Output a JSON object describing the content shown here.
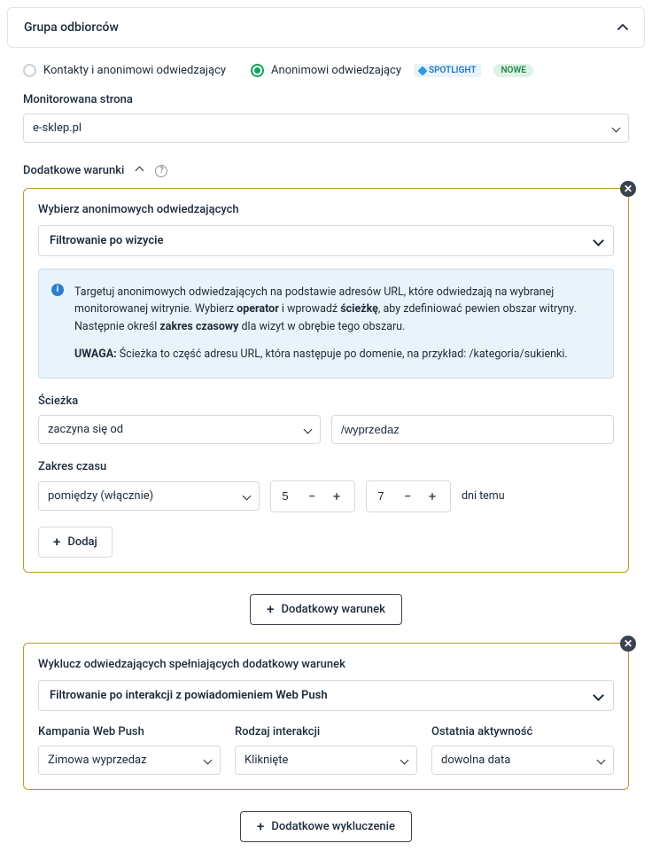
{
  "panel": {
    "title": "Grupa odbiorców"
  },
  "radios": {
    "opt1": "Kontakty i anonimowi odwiedzający",
    "opt2": "Anonimowi odwiedzający",
    "spotlight": "SPOTLIGHT",
    "new": "NOWE"
  },
  "monitored": {
    "label": "Monitorowana strona",
    "value": "e-sklep.pl"
  },
  "additional": {
    "label": "Dodatkowe warunki"
  },
  "filter1": {
    "title": "Wybierz anonimowych odwiedzających",
    "select": "Filtrowanie po wizycie",
    "info_p1_a": "Targetuj anonimowych odwiedzających na podstawie adresów URL, które odwiedzają na wybranej monitorowanej witrynie. Wybierz ",
    "info_op": "operator",
    "info_p1_b": " i wprowadź ",
    "info_path": "ścieżkę",
    "info_p1_c": ", aby zdefiniować pewien obszar witryny. Następnie określ ",
    "info_time": "zakres czasowy",
    "info_p1_d": " dla wizyt w obrębie tego obszaru.",
    "info_p2_a": "UWAGA:",
    "info_p2_b": " Ścieżka to część adresu URL, która następuje po domenie, na przykład: /kategoria/sukienki.",
    "path_label": "Ścieżka",
    "path_operator": "zaczyna się od",
    "path_value": "/wyprzedaz",
    "time_label": "Zakres czasu",
    "time_operator": "pomiędzy (włącznie)",
    "time_from": "5",
    "time_to": "7",
    "time_hint": "dni temu",
    "add_btn": "Dodaj"
  },
  "add_condition_btn": "Dodatkowy warunek",
  "filter2": {
    "title": "Wyklucz odwiedzających spełniających dodatkowy warunek",
    "select": "Filtrowanie po interakcji z powiadomieniem Web Push",
    "camp_label": "Kampania Web Push",
    "camp_value": "Zimowa wyprzedaz",
    "type_label": "Rodzaj interakcji",
    "type_value": "Kliknięte",
    "last_label": "Ostatnia aktywność",
    "last_value": "dowolna data"
  },
  "add_exclusion_btn": "Dodatkowe wykluczenie"
}
